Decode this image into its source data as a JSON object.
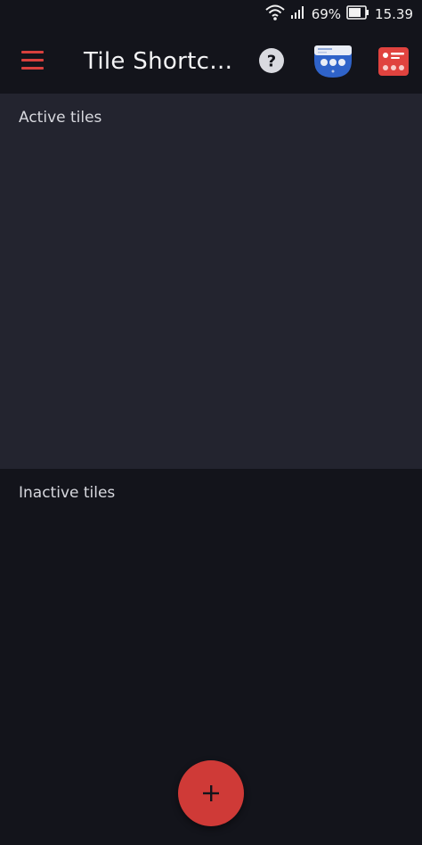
{
  "status_bar": {
    "battery_percent": "69%",
    "time": "15.39"
  },
  "toolbar": {
    "title": "Tile Shortc…",
    "menu_icon": "hamburger-menu-icon",
    "help_icon": "help-circle-icon",
    "tiles_icon": "quick-settings-tiles-icon",
    "settings_icon": "tile-card-icon"
  },
  "sections": {
    "active_label": "Active tiles",
    "inactive_label": "Inactive tiles"
  },
  "fab": {
    "icon": "plus-icon"
  },
  "colors": {
    "accent": "#d8403d",
    "background": "#13141b",
    "active_panel": "#23242f",
    "tile_blue": "#2f63c9"
  }
}
